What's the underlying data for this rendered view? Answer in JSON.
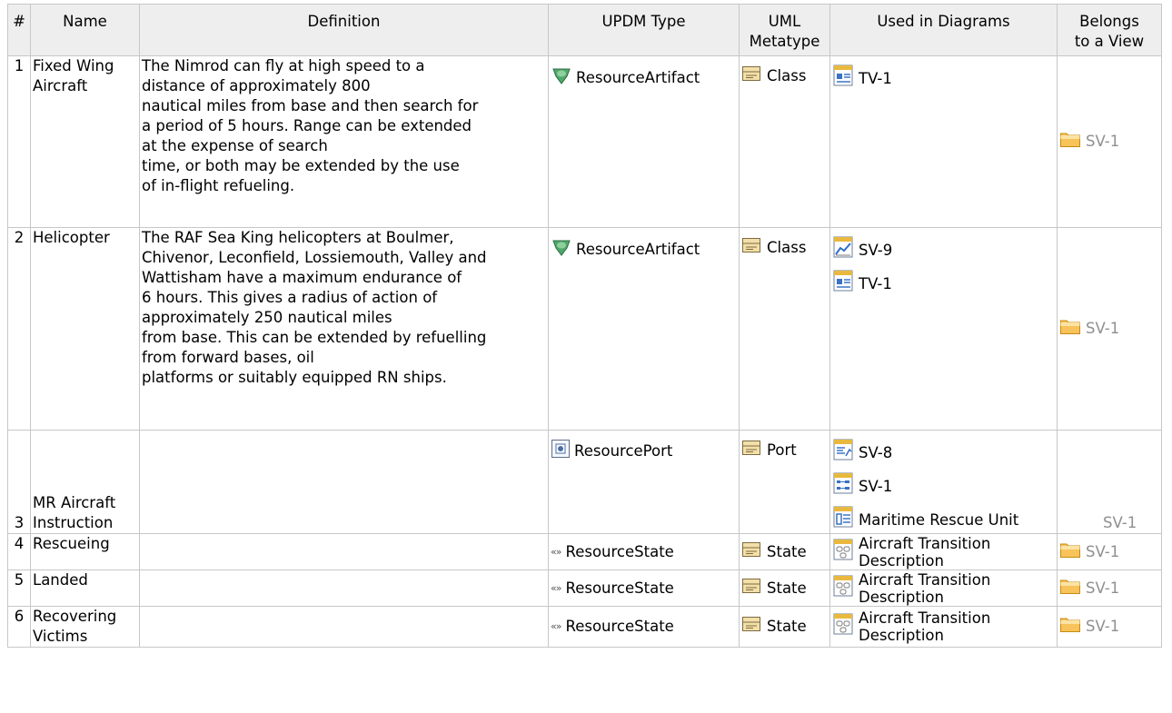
{
  "columns": {
    "num": "#",
    "name": "Name",
    "definition": "Definition",
    "updm_type": "UPDM Type",
    "uml_metatype": "UML\nMetatype",
    "used_in_diagrams": "Used in Diagrams",
    "belongs_to_view": "Belongs\nto a View"
  },
  "rows": [
    {
      "num": "1",
      "name": "Fixed Wing\nAircraft",
      "definition": "The Nimrod can fly at high speed to a\ndistance of approximately 800\nnautical miles from base and then search for\na period of 5 hours. Range can be extended\nat the expense of search\ntime, or both may be extended by the use\nof in-flight refueling.",
      "updm_type": "ResourceArtifact",
      "updm_icon": "resource-artifact-icon",
      "metatype": "Class",
      "diagrams": [
        {
          "label": "TV-1",
          "icon": "tv-diagram-icon"
        }
      ],
      "view": "SV-1"
    },
    {
      "num": "2",
      "name": "Helicopter",
      "definition": "The RAF Sea King helicopters at Boulmer,\nChivenor, Leconfield, Lossiemouth, Valley and\nWattisham have a maximum endurance of\n6 hours. This gives a radius of action of\napproximately 250 nautical miles\nfrom base. This can be extended by refuelling\nfrom forward bases, oil\nplatforms or suitably equipped RN ships.",
      "updm_type": "ResourceArtifact",
      "updm_icon": "resource-artifact-icon",
      "metatype": "Class",
      "diagrams": [
        {
          "label": "SV-9",
          "icon": "sv9-diagram-icon"
        },
        {
          "label": "TV-1",
          "icon": "tv-diagram-icon"
        }
      ],
      "view": "SV-1"
    },
    {
      "num": "3",
      "name": "MR Aircraft\nInstruction",
      "definition": "",
      "updm_type": "ResourcePort",
      "updm_icon": "resource-port-icon",
      "metatype": "Port",
      "diagrams": [
        {
          "label": "SV-8",
          "icon": "sv8-diagram-icon"
        },
        {
          "label": "SV-1",
          "icon": "sv1-diagram-icon"
        },
        {
          "label": "Maritime Rescue Unit",
          "icon": "table-diagram-icon"
        }
      ],
      "view": "SV-1"
    },
    {
      "num": "4",
      "name": "Rescueing",
      "definition": "",
      "updm_type": "ResourceState",
      "updm_icon": "resource-state-icon",
      "metatype": "State",
      "diagrams": [
        {
          "label": "Aircraft Transition\nDescription",
          "icon": "state-diagram-icon"
        }
      ],
      "view": "SV-1"
    },
    {
      "num": "5",
      "name": "Landed",
      "definition": "",
      "updm_type": "ResourceState",
      "updm_icon": "resource-state-icon",
      "metatype": "State",
      "diagrams": [
        {
          "label": "Aircraft Transition\nDescription",
          "icon": "state-diagram-icon"
        }
      ],
      "view": "SV-1"
    },
    {
      "num": "6",
      "name": "Recovering\nVictims",
      "definition": "",
      "updm_type": "ResourceState",
      "updm_icon": "resource-state-icon",
      "metatype": "State",
      "diagrams": [
        {
          "label": "Aircraft Transition\nDescription",
          "icon": "state-diagram-icon"
        }
      ],
      "view": "SV-1"
    }
  ]
}
